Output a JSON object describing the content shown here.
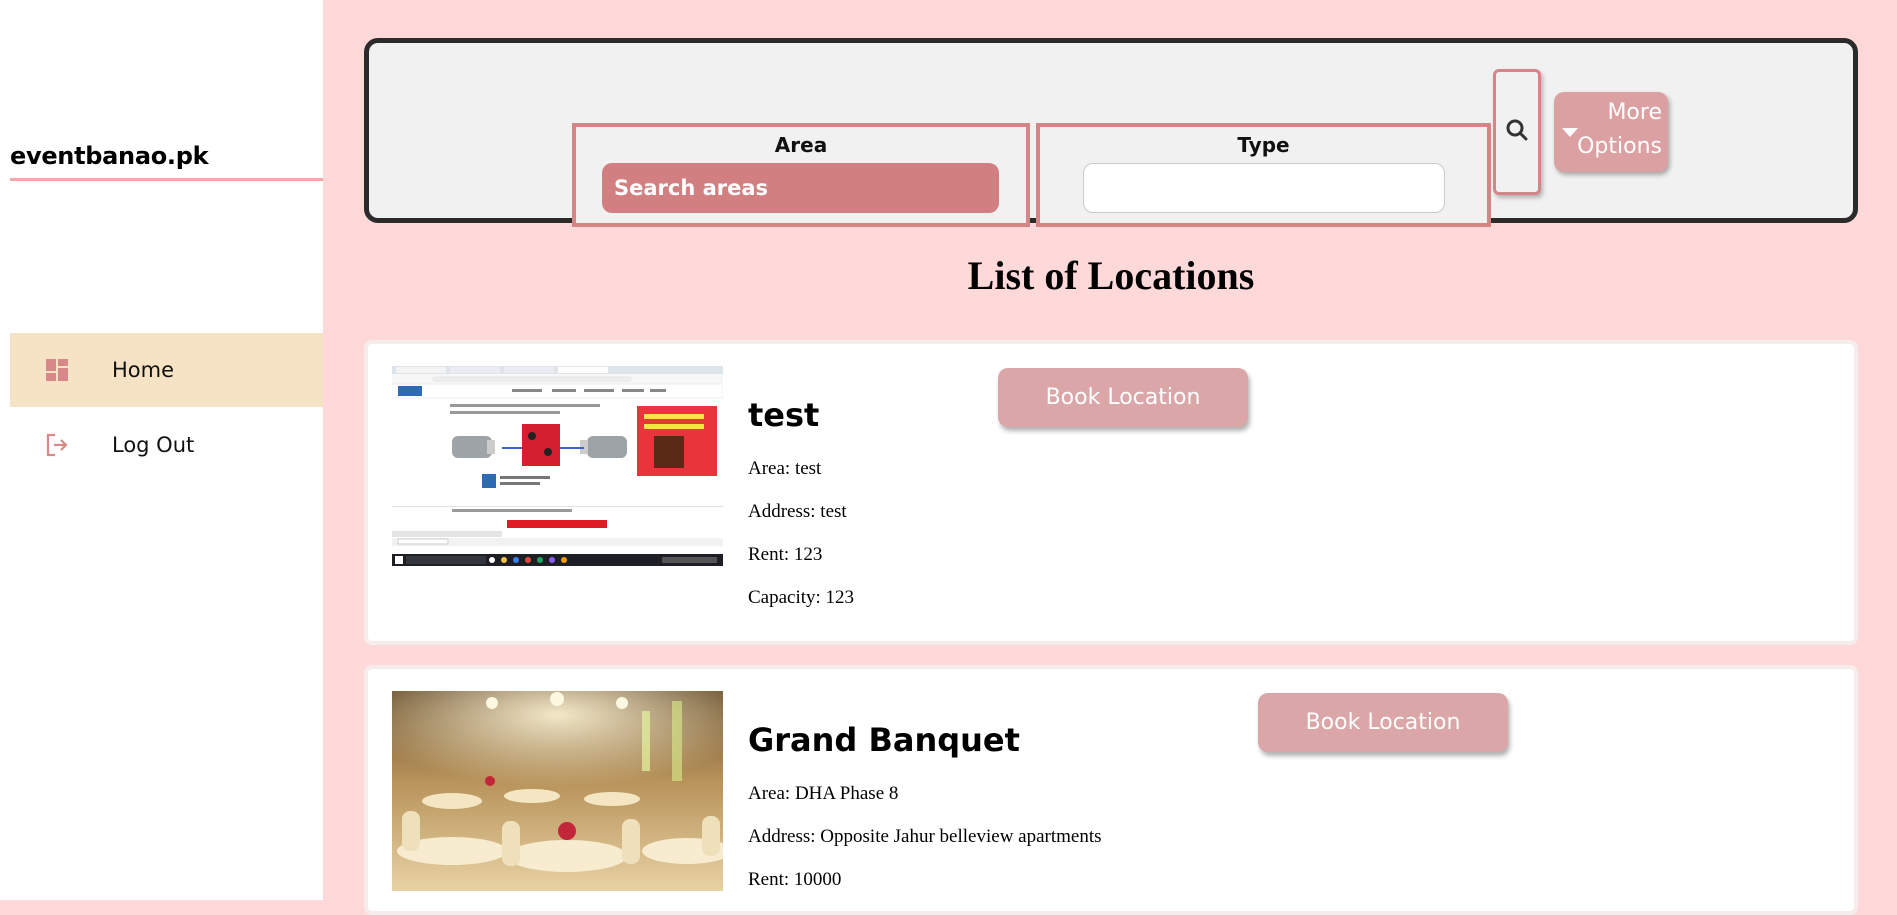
{
  "brand": "eventbanao.pk",
  "sidebar": {
    "items": [
      {
        "label": "Home",
        "icon": "dashboard-icon",
        "active": true
      },
      {
        "label": "Log Out",
        "icon": "logout-icon",
        "active": false
      }
    ]
  },
  "search": {
    "area_label": "Area",
    "area_placeholder": "Search areas",
    "type_label": "Type",
    "type_value": "",
    "search_icon": "search-icon",
    "more_line1": "More",
    "more_line2": "Options"
  },
  "list_title": "List of Locations",
  "locations": [
    {
      "name": "test",
      "area": "Area: test",
      "address": "Address: test",
      "rent": "Rent: 123",
      "capacity": "Capacity: 123",
      "book_label": "Book Location"
    },
    {
      "name": "Grand Banquet",
      "area": "Area: DHA Phase 8",
      "address": "Address: Opposite Jahur belleview apartments",
      "rent": "Rent: 10000",
      "book_label": "Book Location"
    }
  ],
  "colors": {
    "background": "#ffd8d9",
    "accent": "#d17f80",
    "button": "#dba6a8",
    "active_nav": "#f6e3c6",
    "underline": "#f2a9ab"
  }
}
